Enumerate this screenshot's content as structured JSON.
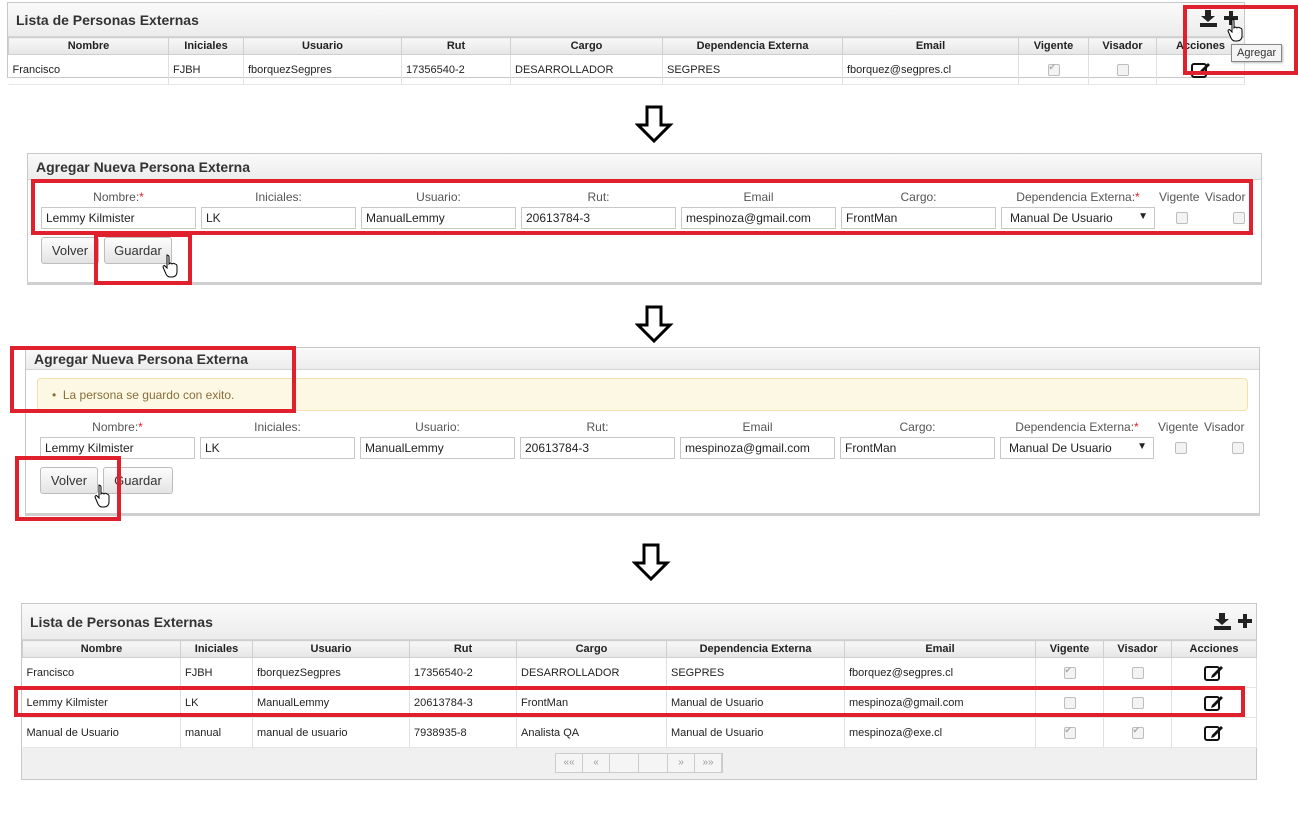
{
  "list": {
    "title": "Lista de Personas Externas",
    "columns": [
      "Nombre",
      "Iniciales",
      "Usuario",
      "Rut",
      "Cargo",
      "Dependencia Externa",
      "Email",
      "Vigente",
      "Visador",
      "Acciones"
    ],
    "rows_top": [
      {
        "nombre": "Francisco",
        "iniciales": "FJBH",
        "usuario": "fborquezSegpres",
        "rut": "17356540-2",
        "cargo": "DESARROLLADOR",
        "dependencia": "SEGPRES",
        "email": "fborquez@segpres.cl",
        "vigente": true,
        "visador": false
      }
    ],
    "rows_bottom": [
      {
        "nombre": "Francisco",
        "iniciales": "FJBH",
        "usuario": "fborquezSegpres",
        "rut": "17356540-2",
        "cargo": "DESARROLLADOR",
        "dependencia": "SEGPRES",
        "email": "fborquez@segpres.cl",
        "vigente": true,
        "visador": false
      },
      {
        "nombre": "Lemmy Kilmister",
        "iniciales": "LK",
        "usuario": "ManualLemmy",
        "rut": "20613784-3",
        "cargo": "FrontMan",
        "dependencia": "Manual de Usuario",
        "email": "mespinoza@gmail.com",
        "vigente": false,
        "visador": false
      },
      {
        "nombre": "Manual de Usuario",
        "iniciales": "manual",
        "usuario": "manual de usuario",
        "rut": "7938935-8",
        "cargo": "Analista QA",
        "dependencia": "Manual de Usuario",
        "email": "mespinoza@exe.cl",
        "vigente": true,
        "visador": true
      }
    ],
    "add_tooltip": "Agregar",
    "pager": [
      "««",
      "«",
      "",
      "",
      "»",
      "»»"
    ]
  },
  "form": {
    "title": "Agregar Nueva Persona Externa",
    "labels": {
      "nombre": "Nombre:",
      "iniciales": "Iniciales:",
      "usuario": "Usuario:",
      "rut": "Rut:",
      "email": "Email",
      "cargo": "Cargo:",
      "dependencia": "Dependencia Externa:",
      "vigente": "Vigente",
      "visador": "Visador"
    },
    "required_mark": "*",
    "values": {
      "nombre": "Lemmy Kilmister",
      "iniciales": "LK",
      "usuario": "ManualLemmy",
      "rut": "20613784-3",
      "email": "mespinoza@gmail.com",
      "cargo": "FrontMan",
      "dependencia": "Manual De Usuario"
    },
    "buttons": {
      "volver": "Volver",
      "guardar": "Guardar"
    },
    "success_message": "La persona se guardo con exito."
  },
  "colors": {
    "highlight": "#e0202c",
    "alert_bg": "#fcf8e3"
  }
}
